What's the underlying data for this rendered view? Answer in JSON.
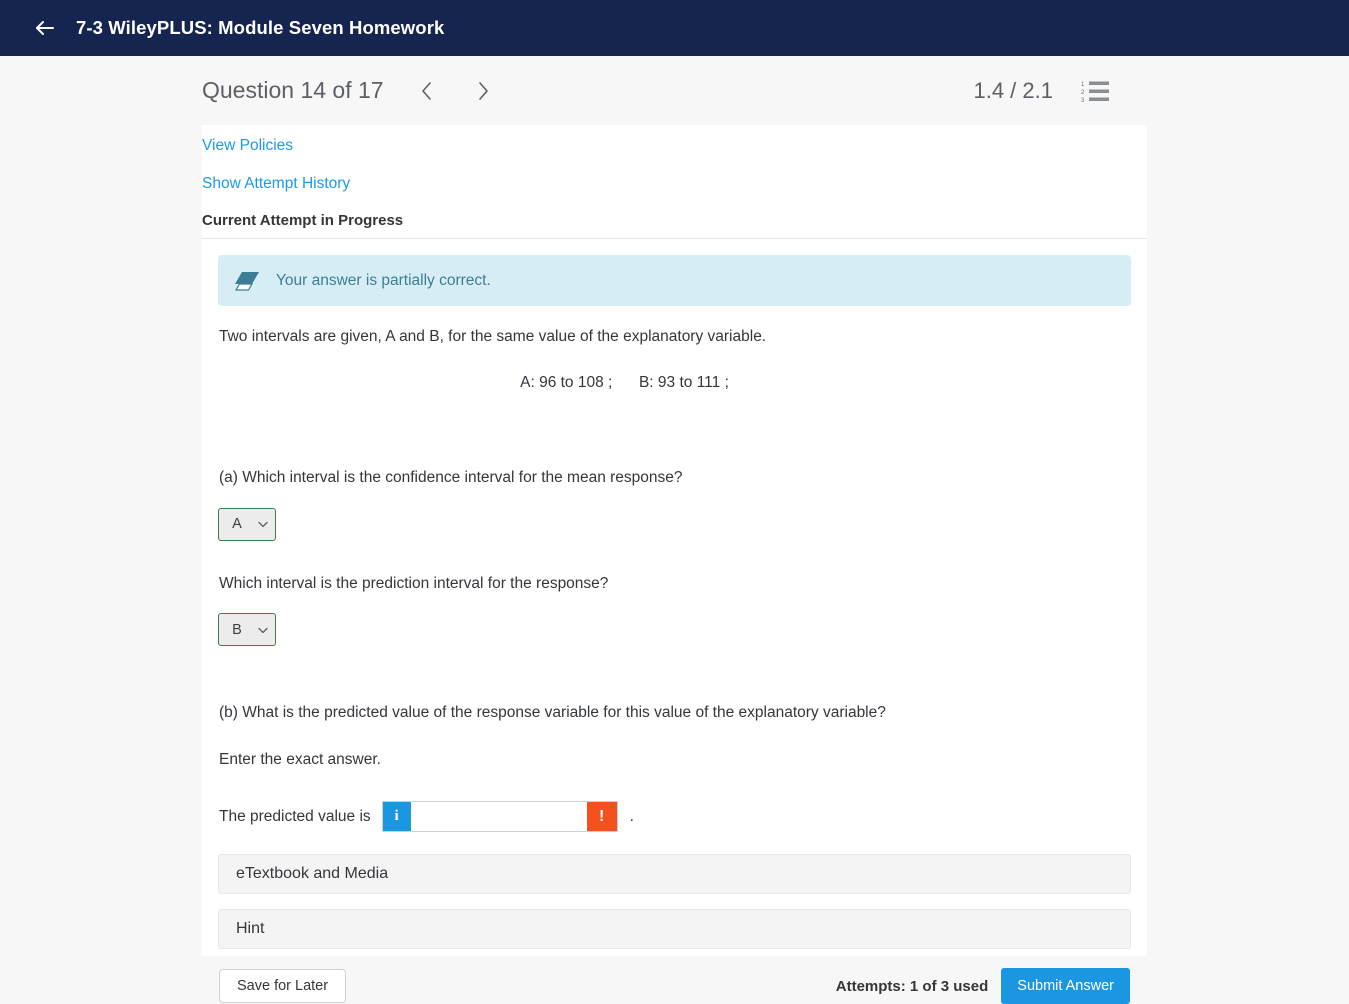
{
  "appbar": {
    "back_icon": "arrow-left-icon",
    "title": "7-3 WileyPLUS: Module Seven Homework"
  },
  "question_bar": {
    "title": "Question 14 of 17",
    "prev_icon": "chevron-left-icon",
    "next_icon": "chevron-right-icon",
    "score": "1.4 / 2.1",
    "list_icon": "numbered-list-icon"
  },
  "panel": {
    "view_policies": "View Policies",
    "show_attempt_history": "Show Attempt History",
    "attempt_status": "Current Attempt in Progress"
  },
  "banner": {
    "icon": "eraser-icon",
    "text": "Your answer is partially correct.",
    "background": "#d7edf5",
    "text_color": "#3c7e95"
  },
  "question": {
    "intro": "Two intervals are given, A and B, for the same value of the explanatory variable.",
    "interval_a": "A: 96 to 108 ;",
    "interval_b": "B: 93 to 111 ;",
    "part_a": "(a) Which interval is the confidence interval for the mean response?",
    "part_a2": "Which interval is the prediction interval for the response?",
    "part_b": "(b) What is the predicted value of the response variable for this value of the explanatory variable?",
    "part_b_note": "Enter the exact answer.",
    "answer_label": "The predicted value is",
    "answer_value": "",
    "answer_placeholder": "",
    "answer_period": ".",
    "info_badge": "i",
    "error_badge": "!"
  },
  "dropdowns": [
    {
      "name": "confidence-interval-select",
      "value": "A",
      "caret": "chevron-down-icon",
      "border_color": "#3c7d4e"
    },
    {
      "name": "prediction-interval-select",
      "value": "B",
      "caret": "chevron-down-icon",
      "border_color": "#3c7d4e"
    }
  ],
  "accordions": [
    {
      "label": "eTextbook and Media"
    },
    {
      "label": "Hint"
    }
  ],
  "footer": {
    "save_label": "Save for Later",
    "attempts": "Attempts: 1 of 3 used",
    "submit_label": "Submit Answer",
    "submit_color": "#1b96e0"
  }
}
